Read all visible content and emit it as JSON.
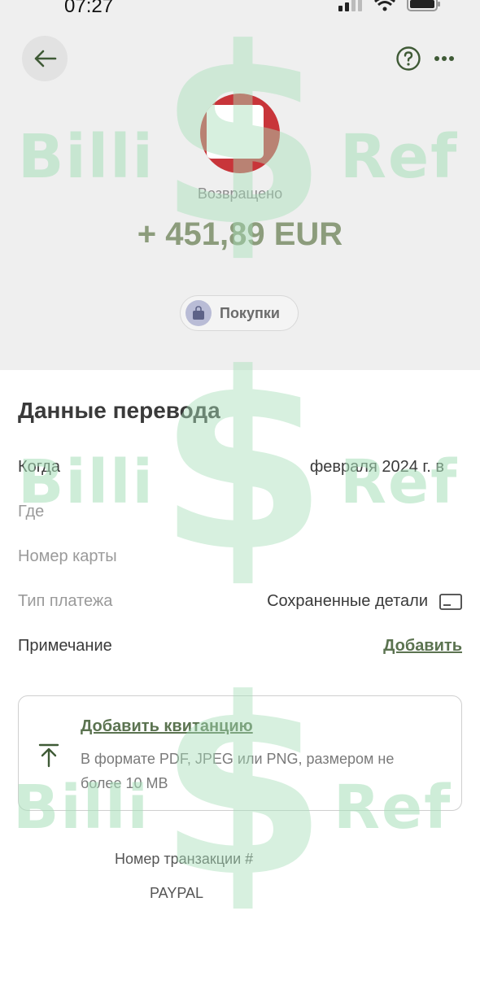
{
  "status_bar": {
    "time": "07:27"
  },
  "header": {
    "back_icon": "arrow-left-icon",
    "help_icon": "question-circle-icon",
    "more_icon": "more-dots-icon"
  },
  "summary": {
    "status": "Возвращено",
    "amount": "+ 451,89 EUR",
    "category": "Покупки"
  },
  "details": {
    "title": "Данные перевода",
    "rows": [
      {
        "label": "Когда",
        "value": "февраля 2024 г. в"
      },
      {
        "label": "Где",
        "value": ""
      },
      {
        "label": "Номер карты",
        "value": ""
      },
      {
        "label": "Тип платежа",
        "value": "Сохраненные детали"
      },
      {
        "label": "Примечание",
        "action": "Добавить"
      }
    ]
  },
  "receipt": {
    "title": "Добавить квитанцию",
    "description": "В формате PDF, JPEG или PNG, размером не более 10 MB"
  },
  "footer": {
    "transaction_label": "Номер транзакции #",
    "paypal_label": "PAYPAL"
  },
  "watermark": {
    "left_text": "Billi",
    "right_text": "Ref",
    "symbol": "$"
  },
  "colors": {
    "accent": "#5b7350",
    "amount": "#8c9c7c",
    "avatar": "#c8353a"
  }
}
